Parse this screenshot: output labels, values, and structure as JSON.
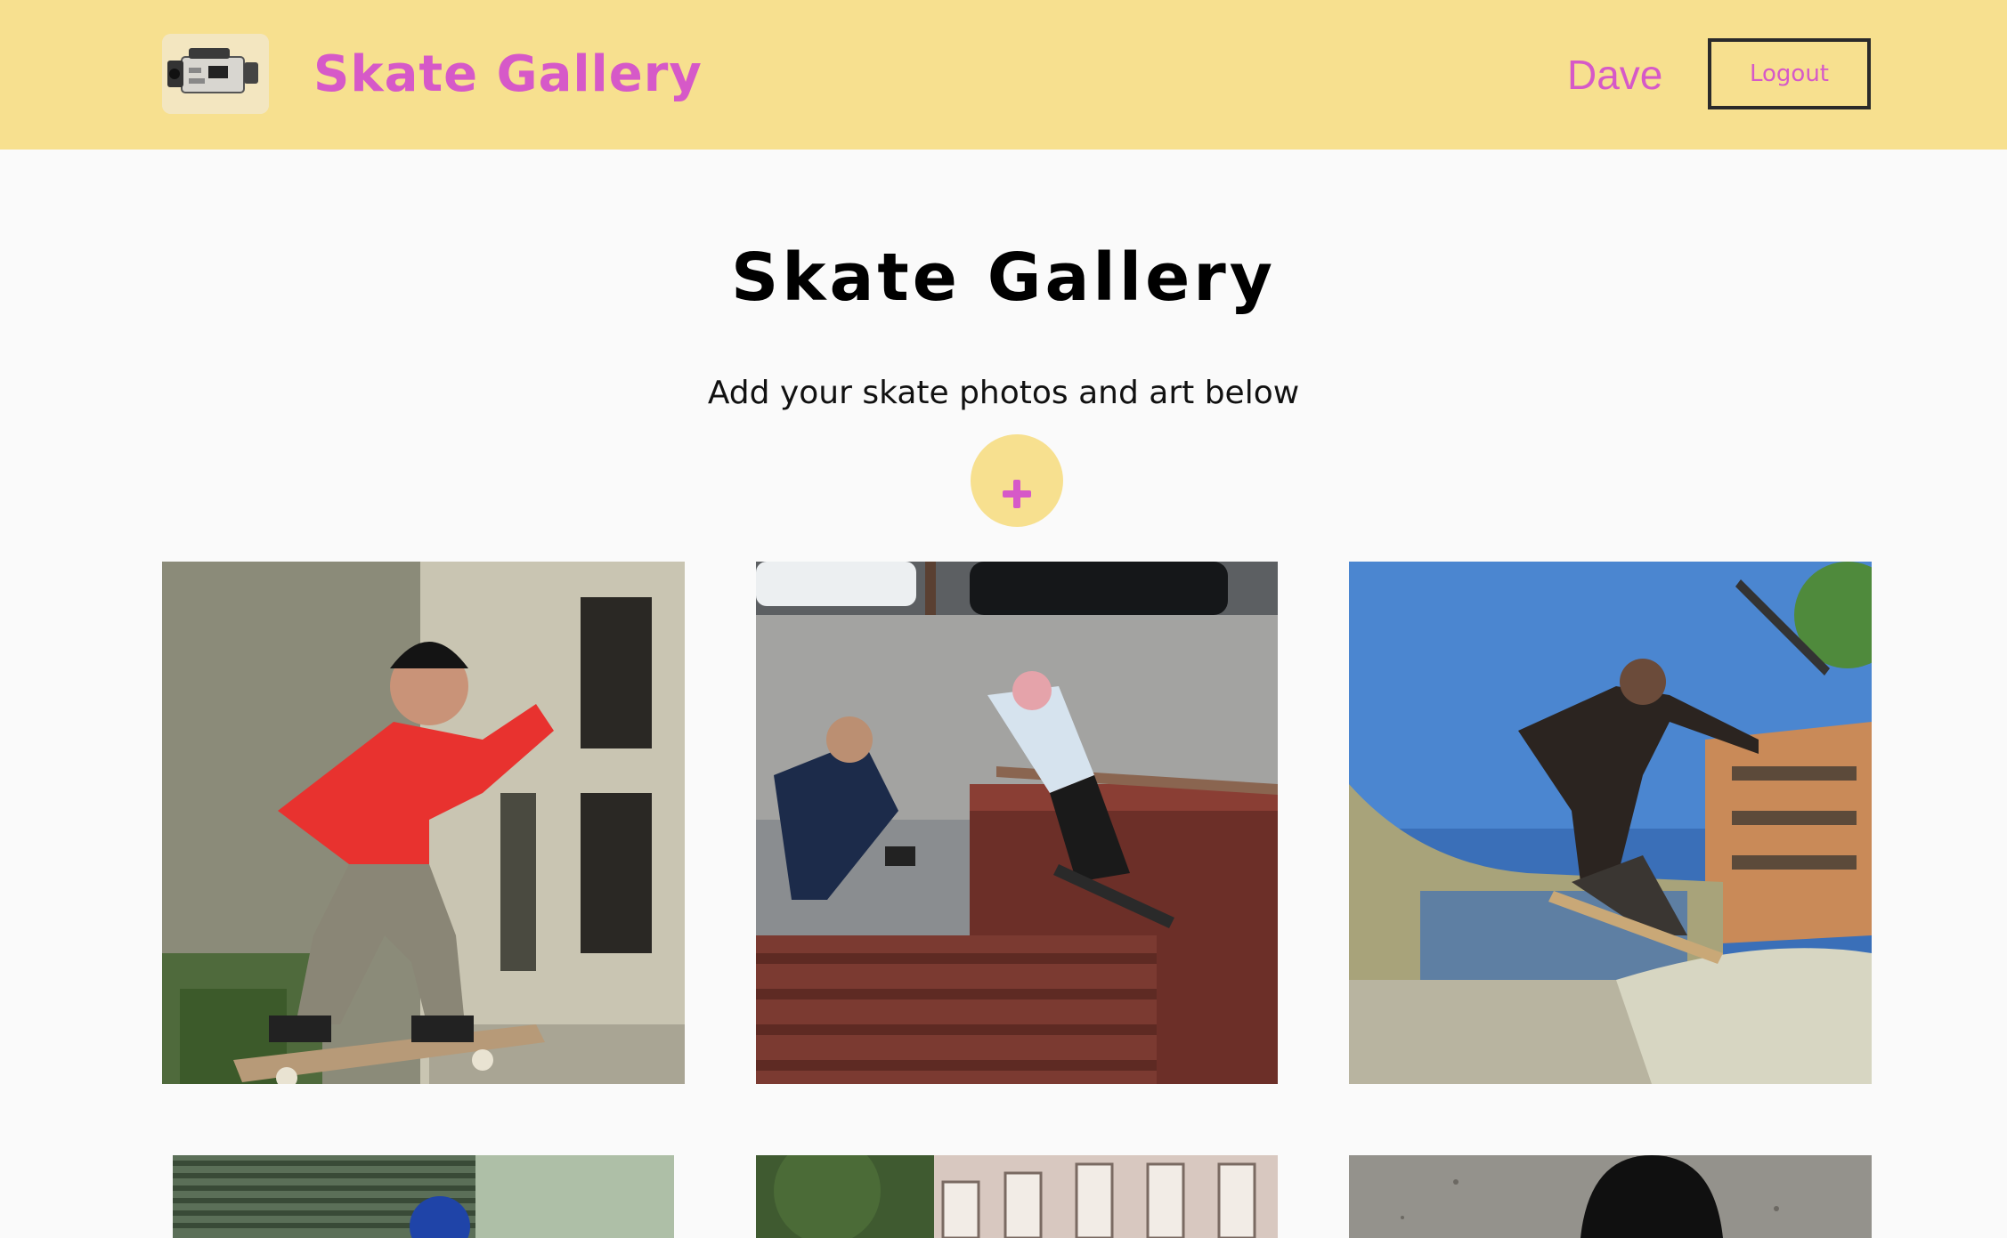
{
  "navbar": {
    "brand_title": "Skate Gallery",
    "brand_logo_icon": "camcorder-icon",
    "user_name": "Dave",
    "logout_label": "Logout"
  },
  "main": {
    "title": "Skate Gallery",
    "subtitle": "Add your skate photos and art below",
    "add_icon": "plus-icon"
  },
  "colors": {
    "navbar_bg": "#f7e08f",
    "accent_pink": "#d659c8",
    "page_bg": "#fafafa"
  },
  "gallery": {
    "photos": [
      "skater-red-shirt",
      "skater-ledge-filmer",
      "skater-fisheye-ramp",
      "skater-blue-cap",
      "skater-building",
      "skateboard-griptape"
    ]
  }
}
